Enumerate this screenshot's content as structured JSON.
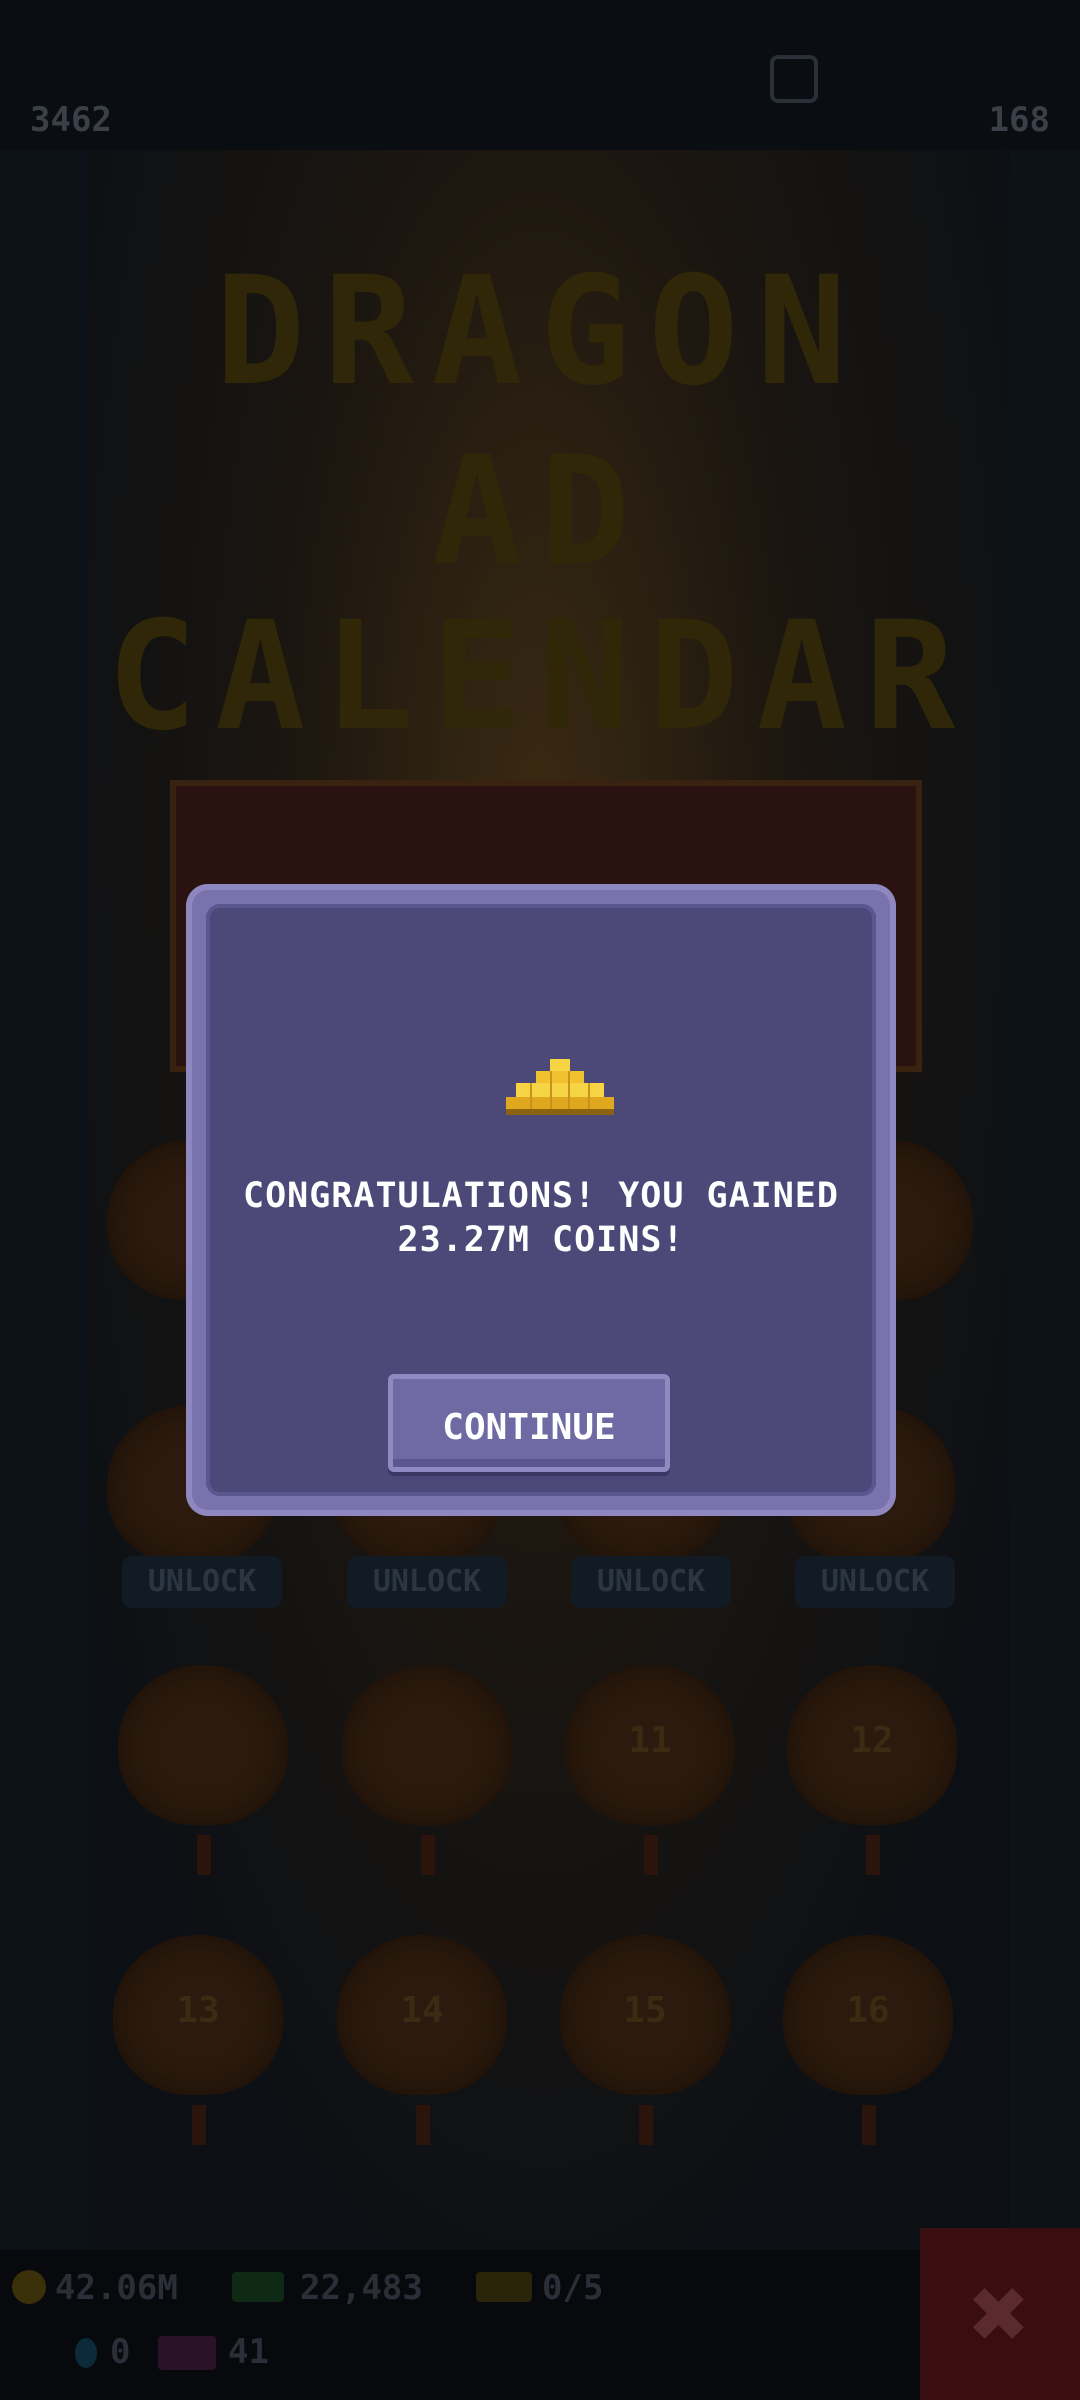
{
  "top_bar": {
    "left_value": "3462",
    "right_value": "168"
  },
  "title": {
    "line1": "DRAGON",
    "line2": "AD",
    "line3": "CALENDAR"
  },
  "lanterns": [
    {
      "label": "UNLOCK",
      "label2": "UNLOCK",
      "label3": "UNLOCK",
      "label4": "UNLOCK"
    },
    {
      "num": "",
      "num2": "",
      "num3": "11",
      "num4": "12"
    },
    {
      "num": "13",
      "num2": "14",
      "num3": "15",
      "num4": "16"
    }
  ],
  "bottom_bar": {
    "coins": "42.06M",
    "cash": "22,483",
    "tickets": "0/5",
    "gems": "0",
    "tokens": "41"
  },
  "dialog": {
    "message": "CONGRATULATIONS! YOU GAINED 23.27M COINS!",
    "button_label": "CONTINUE",
    "reward_icon": "gold-bars-icon"
  },
  "colors": {
    "dialog_frame": "#7a72ad",
    "dialog_body": "#4c4877",
    "button": "#6f69a4",
    "gold": "#f2c12e"
  }
}
